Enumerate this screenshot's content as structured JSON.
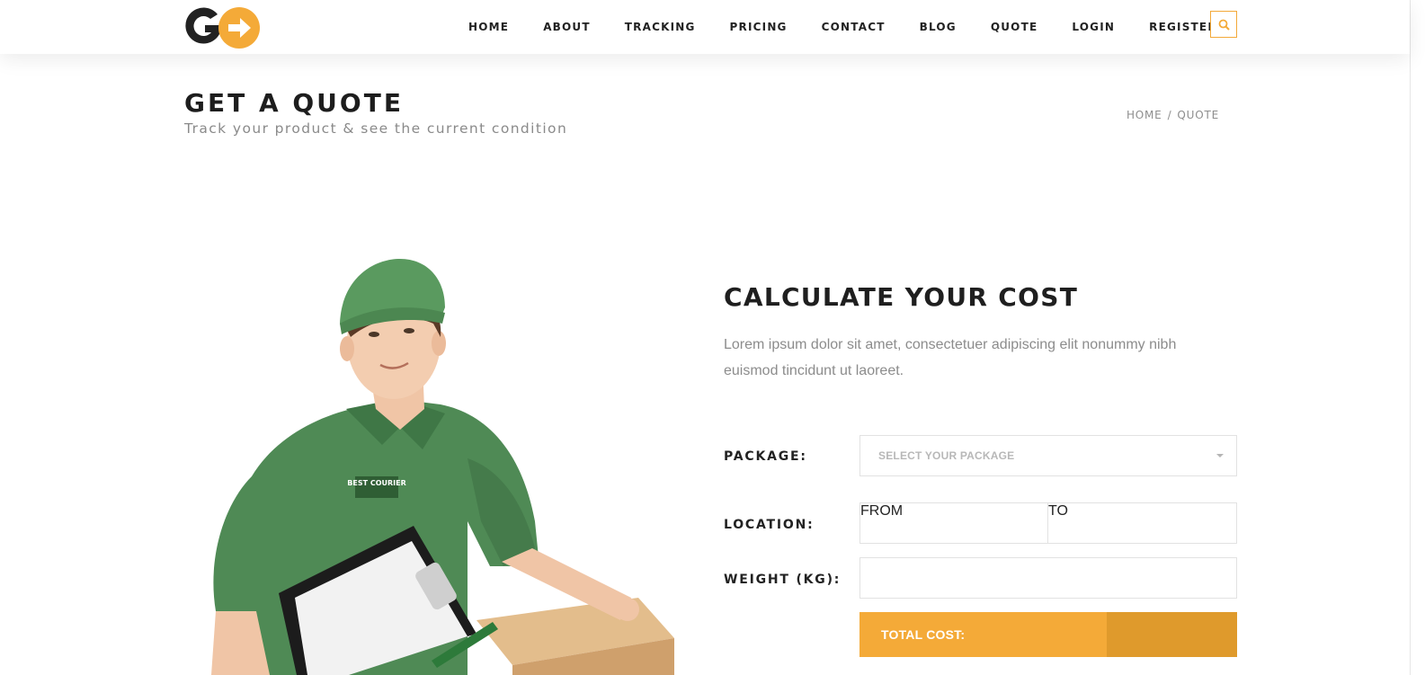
{
  "brand": {
    "logo_text": "GO",
    "accent_color": "#f4aa38",
    "accent_dark": "#df9a2c",
    "dark_color": "#222222"
  },
  "nav": {
    "items": [
      "HOME",
      "ABOUT",
      "TRACKING",
      "PRICING",
      "CONTACT",
      "BLOG",
      "QUOTE",
      "LOGIN",
      "REGISTER"
    ],
    "search_icon": "search-icon"
  },
  "page_header": {
    "title": "GET A QUOTE",
    "subtitle": "Track your product & see the current condition",
    "breadcrumb": [
      "HOME",
      "/",
      "QUOTE"
    ]
  },
  "calculator": {
    "title": "CALCULATE YOUR COST",
    "description": "Lorem ipsum dolor sit amet, consectetuer adipiscing elit nonummy nibh euismod tincidunt ut laoreet.",
    "package_label": "PACKAGE:",
    "package_placeholder": "SELECT YOUR PACKAGE",
    "location_label": "LOCATION:",
    "from_placeholder": "FROM",
    "to_placeholder": "TO",
    "weight_label": "WEIGHT (KG):",
    "weight_value": "",
    "total_label": "TOTAL COST:",
    "total_value": ""
  },
  "illustration": {
    "shirt_logo_text": "BEST COURIER"
  }
}
